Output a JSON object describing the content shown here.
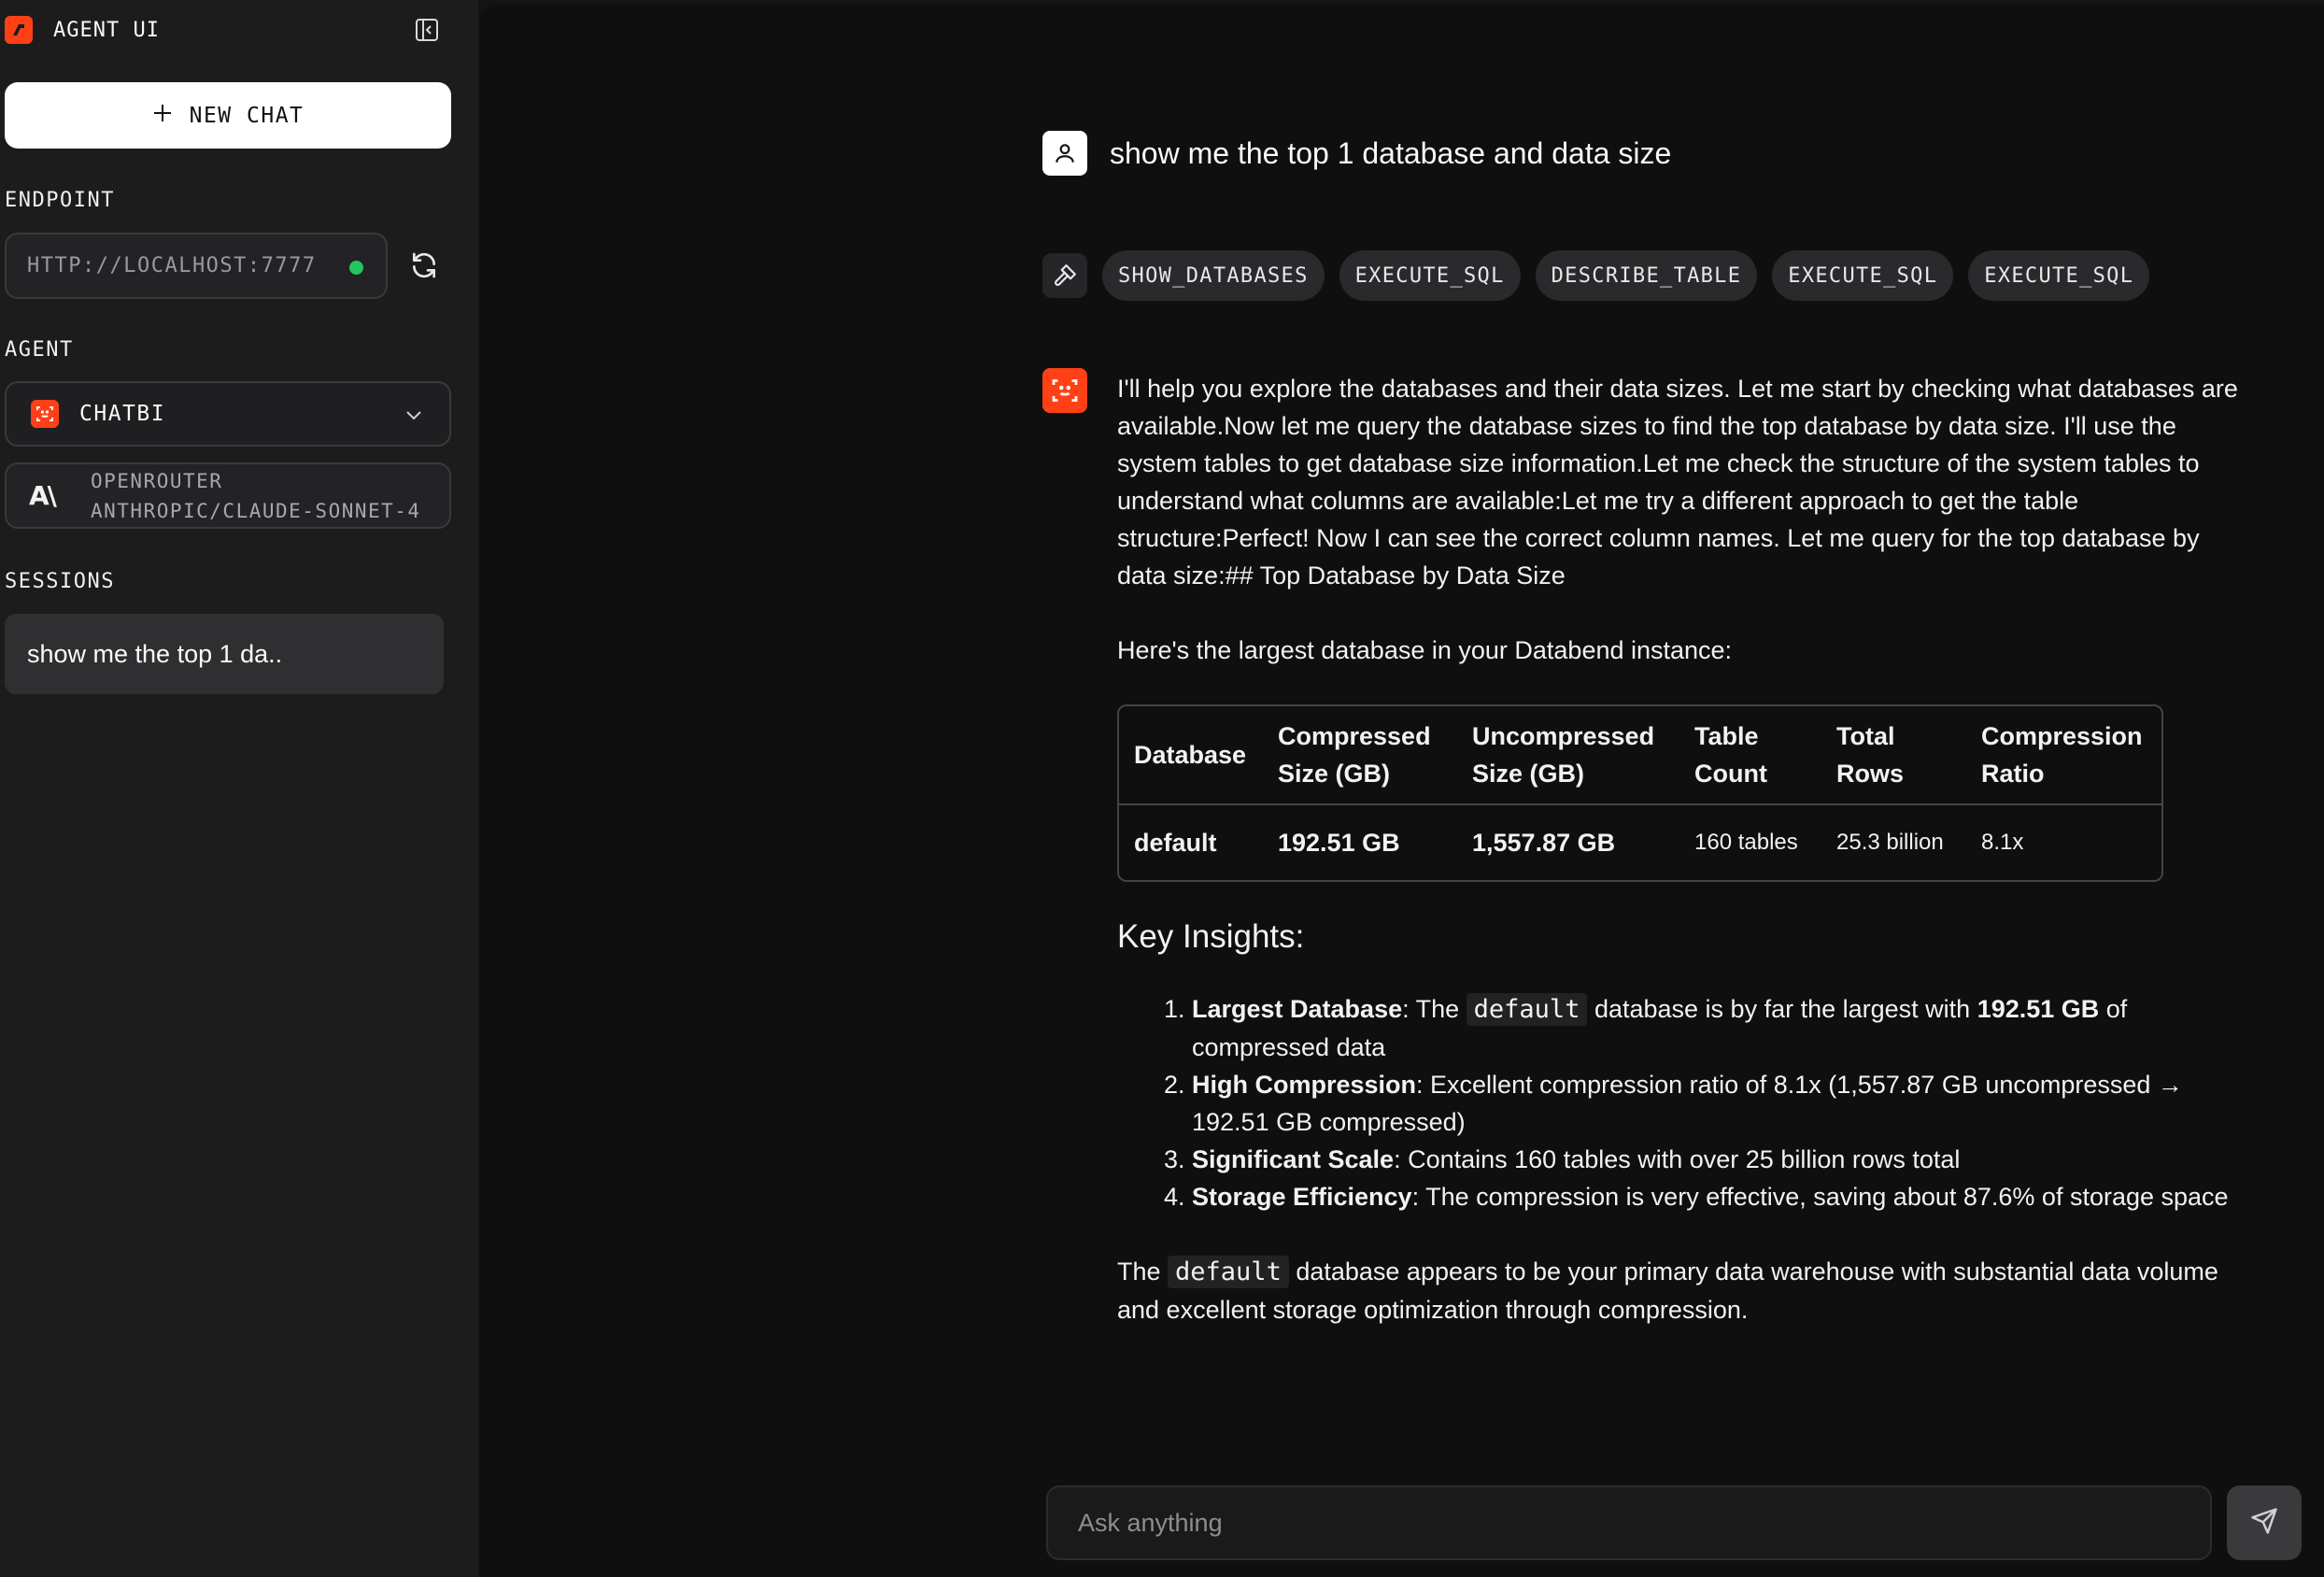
{
  "sidebar": {
    "brand": "AGENT UI",
    "new_chat_label": "NEW CHAT",
    "endpoint_label": "ENDPOINT",
    "endpoint_value": "HTTP://LOCALHOST:7777",
    "agent_label": "AGENT",
    "agent_selected": "CHATBI",
    "model_provider": "OPENROUTER",
    "model_name": "ANTHROPIC/CLAUDE-SONNET-4",
    "sessions_label": "SESSIONS",
    "sessions": [
      {
        "title": "show me the top 1 da.."
      }
    ]
  },
  "chat": {
    "user_message": "show me the top 1 database and data size",
    "tool_calls": [
      "SHOW_DATABASES",
      "EXECUTE_SQL",
      "DESCRIBE_TABLE",
      "EXECUTE_SQL",
      "EXECUTE_SQL"
    ],
    "assistant": {
      "intro": "I'll help you explore the databases and their data sizes. Let me start by checking what databases are available.Now let me query the database sizes to find the top database by data size. I'll use the system tables to get database size information.Let me check the structure of the system tables to understand what columns are available:Let me try a different approach to get the table structure:Perfect! Now I can see the correct column names. Let me query for the top database by data size:## Top Database by Data Size",
      "lead": "Here's the largest database in your Databend instance:",
      "table": {
        "headers": [
          "Database",
          "Compressed Size (GB)",
          "Uncompressed Size (GB)",
          "Table Count",
          "Total Rows",
          "Compression Ratio"
        ],
        "rows": [
          [
            "default",
            "192.51 GB",
            "1,557.87 GB",
            "160 tables",
            "25.3 billion",
            "8.1x"
          ]
        ]
      },
      "insights_heading": "Key Insights:",
      "insights": [
        {
          "title": "Largest Database",
          "pre": ": The ",
          "code": "default",
          "post": " database is by far the largest with ",
          "strong": "192.51 GB",
          "tail": " of compressed data"
        },
        {
          "title": "High Compression",
          "text": ": Excellent compression ratio of 8.1x (1,557.87 GB uncompressed → 192.51 GB compressed)"
        },
        {
          "title": "Significant Scale",
          "text": ": Contains 160 tables with over 25 billion rows total"
        },
        {
          "title": "Storage Efficiency",
          "text": ": The compression is very effective, saving about 87.6% of storage space"
        }
      ],
      "closing_pre": "The ",
      "closing_code": "default",
      "closing_post": " database appears to be your primary data warehouse with substantial data volume and excellent storage optimization through compression."
    }
  },
  "composer": {
    "placeholder": "Ask anything"
  },
  "colors": {
    "accent": "#ff4017",
    "status_online": "#22c55e",
    "sidebar_bg": "#1c1c1d",
    "main_bg": "#0f0f10"
  },
  "icons": {
    "brand": "agent-logo-icon",
    "collapse": "sidebar-collapse-icon",
    "new_chat": "plus-icon",
    "refresh": "refresh-icon",
    "agent": "scan-icon",
    "chevron": "chevron-down-icon",
    "user": "user-icon",
    "tools": "hammer-icon",
    "send": "send-icon"
  }
}
